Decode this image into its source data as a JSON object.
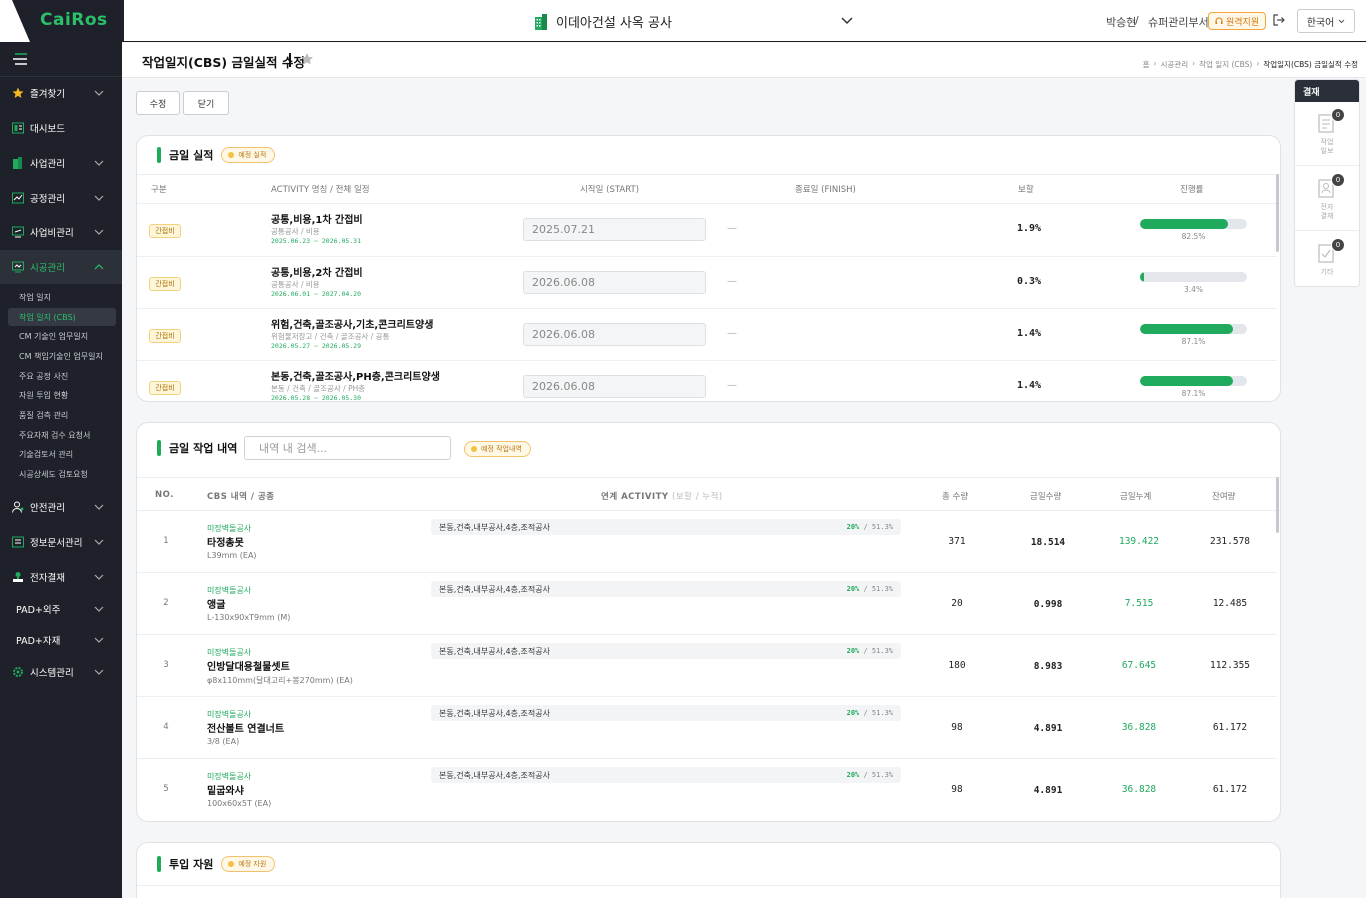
{
  "header": {
    "logo": "CaiRos",
    "project": "이데아건설 사옥 공사",
    "user": "박승현",
    "separator": "/",
    "department": "슈퍼관리부서",
    "remote_support": "원격지원",
    "language": "한국어"
  },
  "sidebar": {
    "items": [
      {
        "label": "즐겨찾기"
      },
      {
        "label": "대시보드"
      },
      {
        "label": "사업관리"
      },
      {
        "label": "공정관리"
      },
      {
        "label": "사업비관리"
      },
      {
        "label": "시공관리"
      },
      {
        "label": "안전관리"
      },
      {
        "label": "정보문서관리"
      },
      {
        "label": "전자결재"
      },
      {
        "label": "PAD+외주"
      },
      {
        "label": "PAD+자재"
      },
      {
        "label": "시스템관리"
      }
    ],
    "sub_items": [
      {
        "label": "작업 일지"
      },
      {
        "label": "작업 일지 (CBS)"
      },
      {
        "label": "CM 기술인 업무일지"
      },
      {
        "label": "CM 책임기술인 업무일지"
      },
      {
        "label": "주요 공정 사진"
      },
      {
        "label": "자원 투입 현황"
      },
      {
        "label": "품질 검측 관리"
      },
      {
        "label": "주요자재 검수 요청서"
      },
      {
        "label": "기술검토서 관리"
      },
      {
        "label": "시공상세도 검토요청"
      }
    ]
  },
  "page": {
    "title": "작업일지(CBS) 금일실적 수정",
    "breadcrumb": [
      "홈",
      "›",
      "시공관리",
      "›",
      "작업 일지 (CBS)",
      "›",
      "작업일지(CBS) 금일실적 수정"
    ],
    "buttons": {
      "edit": "수정",
      "close": "닫기"
    }
  },
  "today_perf": {
    "title": "금일 실적",
    "tag": "예정 실적",
    "columns": [
      "구분",
      "ACTIVITY 명칭 / 전체 일정",
      "시작일 (START)",
      "종료일 (FINISH)",
      "보할",
      "진행률"
    ],
    "rows": [
      {
        "badge": "간접비",
        "name": "공통,비용,1차 간접비",
        "sub": "공통공사 / 비용",
        "dates": "2025.06.23 ~ 2026.05.31",
        "start": "2025.07.21",
        "finish": "—",
        "weight": "1.9%",
        "progress": 0.825,
        "progress_label": "82.5%"
      },
      {
        "badge": "간접비",
        "name": "공통,비용,2차 간접비",
        "sub": "공통공사 / 비용",
        "dates": "2026.06.01 ~ 2027.04.20",
        "start": "2026.06.08",
        "finish": "—",
        "weight": "0.3%",
        "progress": 0.034,
        "progress_label": "3.4%"
      },
      {
        "badge": "간접비",
        "name": "위험,건축,골조공사,기초,콘크리트양생",
        "sub": "위험물저장고 / 건축 / 골조공사 / 공통",
        "dates": "2026.05.27 ~ 2026.05.29",
        "start": "2026.06.08",
        "finish": "—",
        "weight": "1.4%",
        "progress": 0.871,
        "progress_label": "87.1%"
      },
      {
        "badge": "간접비",
        "name": "본동,건축,골조공사,PH층,콘크리트양생",
        "sub": "본동 / 건축 / 골조공사 / PH층",
        "dates": "2026.05.28 ~ 2026.05.30",
        "start": "2026.06.08",
        "finish": "—",
        "weight": "1.4%",
        "progress": 0.871,
        "progress_label": "87.1%"
      }
    ]
  },
  "work_list": {
    "title": "금일 작업 내역",
    "search_placeholder": "내역 내 검색...",
    "tag": "예정 작업내역",
    "columns": {
      "no": "NO.",
      "cbs": "CBS 내역 / 공종",
      "act": "연계 ACTIVITY",
      "act_sub": "(보할 / 누적)",
      "total": "총 수량",
      "today": "금일수량",
      "cum": "금일누계",
      "remain": "잔여량"
    },
    "rows": [
      {
        "no": "1",
        "cat": "미장벽돌공사",
        "name": "타정총못",
        "spec": "L39mm (EA)",
        "activity": "본동,건축,내부공사,4층,조적공사",
        "pct": "20%",
        "pct_cum": " / 51.3%",
        "total": "371",
        "today": "18.514",
        "cum": "139.422",
        "remain": "231.578"
      },
      {
        "no": "2",
        "cat": "미장벽돌공사",
        "name": "앵글",
        "spec": "L-130x90xT9mm (M)",
        "activity": "본동,건축,내부공사,4층,조적공사",
        "pct": "20%",
        "pct_cum": " / 51.3%",
        "total": "20",
        "today": "0.998",
        "cum": "7.515",
        "remain": "12.485"
      },
      {
        "no": "3",
        "cat": "미장벽돌공사",
        "name": "인방달대용철물셋트",
        "spec": "φ8x110mm(달대고리+봉270mm) (EA)",
        "activity": "본동,건축,내부공사,4층,조적공사",
        "pct": "20%",
        "pct_cum": " / 51.3%",
        "total": "180",
        "today": "8.983",
        "cum": "67.645",
        "remain": "112.355"
      },
      {
        "no": "4",
        "cat": "미장벽돌공사",
        "name": "전산볼트 연결너트",
        "spec": "3/8 (EA)",
        "activity": "본동,건축,내부공사,4층,조적공사",
        "pct": "20%",
        "pct_cum": " / 51.3%",
        "total": "98",
        "today": "4.891",
        "cum": "36.828",
        "remain": "61.172"
      },
      {
        "no": "5",
        "cat": "미장벽돌공사",
        "name": "밑굽와샤",
        "spec": "100x60x5T (EA)",
        "activity": "본동,건축,내부공사,4층,조적공사",
        "pct": "20%",
        "pct_cum": " / 51.3%",
        "total": "98",
        "today": "4.891",
        "cum": "36.828",
        "remain": "61.172"
      }
    ]
  },
  "resources": {
    "title": "투입 자원",
    "tag": "예정 자원"
  },
  "approval": {
    "title": "결재",
    "items": [
      {
        "count": "0",
        "label": "작업\n일보"
      },
      {
        "count": "0",
        "label": "전자\n결재"
      },
      {
        "count": "0",
        "label": "기타"
      }
    ]
  },
  "colors": {
    "accent": "#1faa5d",
    "sidebar": "#1e2129",
    "tag_border": "#f2c26a"
  }
}
